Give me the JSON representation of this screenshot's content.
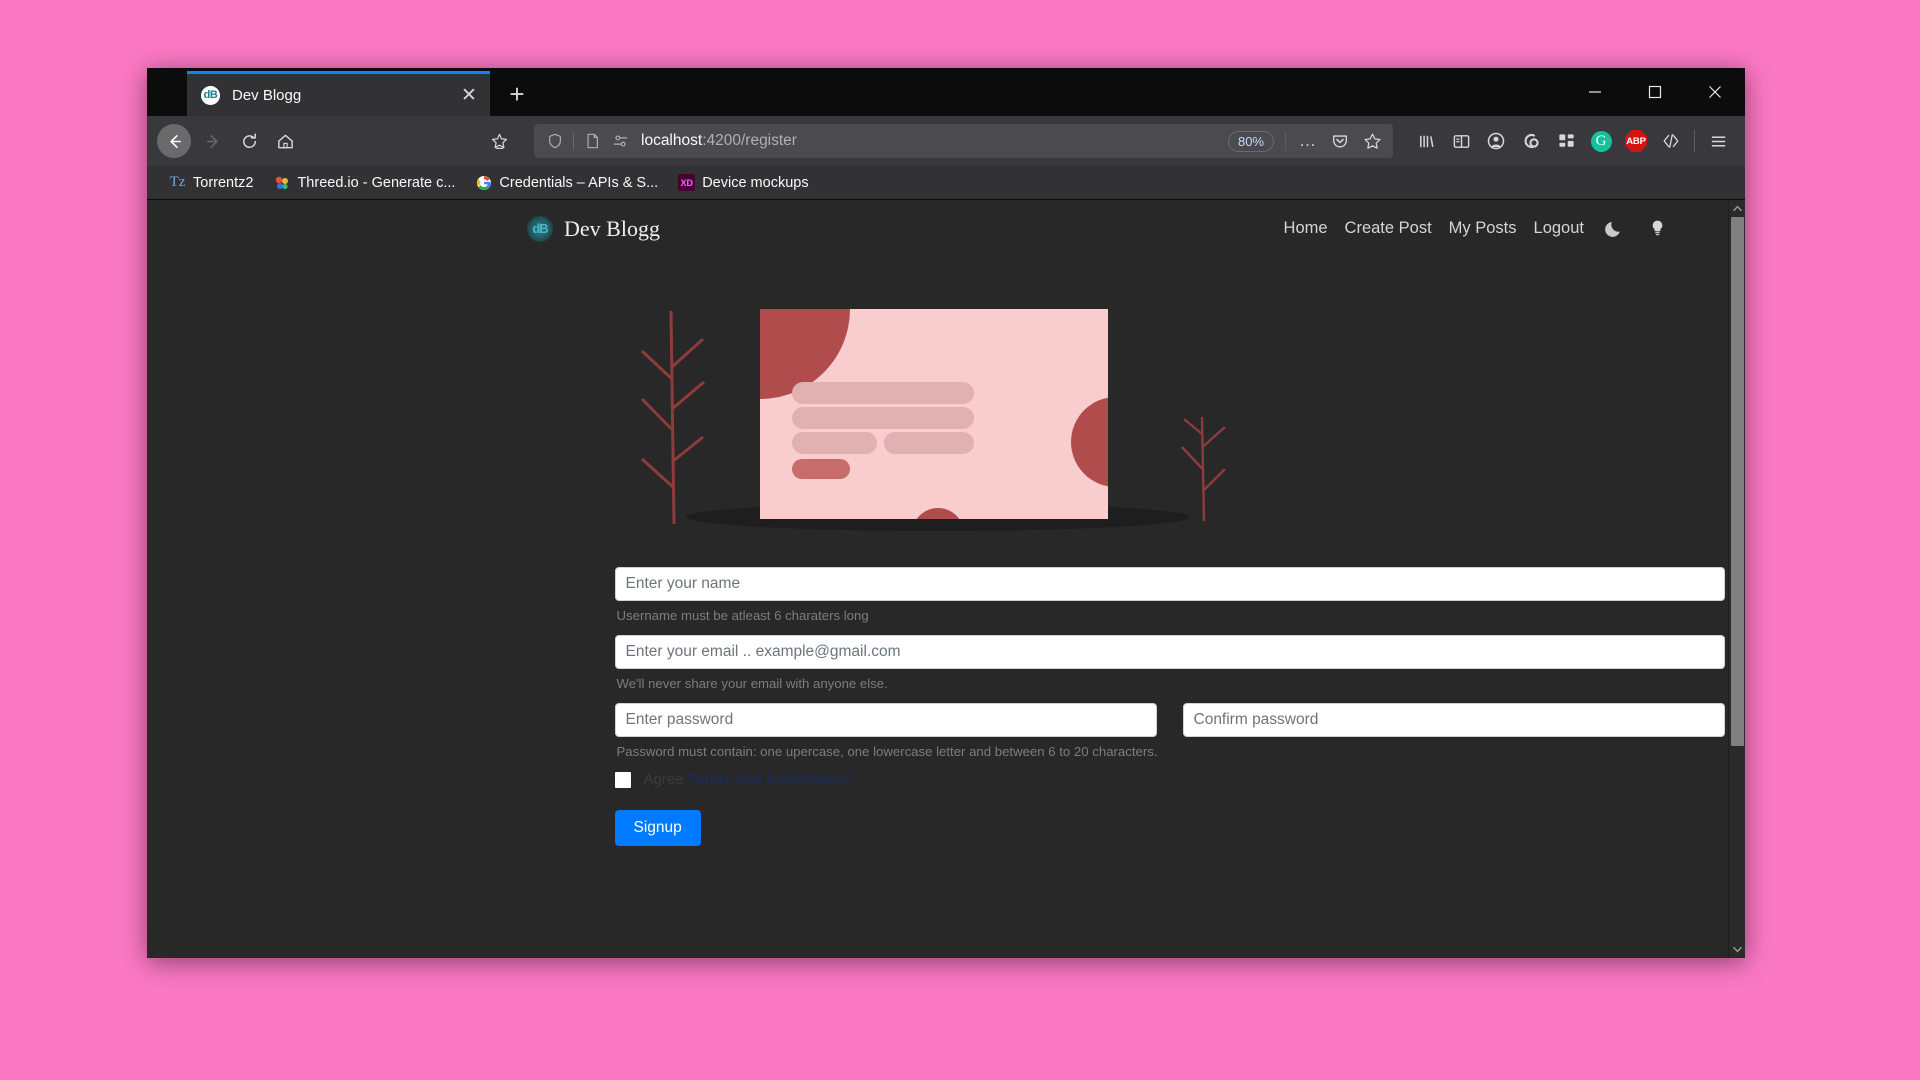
{
  "browser": {
    "tab": {
      "title": "Dev Blogg",
      "favicon_text": "dB",
      "close_label": "✕"
    },
    "new_tab_label": "+",
    "window_controls": {
      "minimize": "minimize-icon",
      "maximize": "maximize-icon",
      "close": "close-icon"
    },
    "nav": {
      "back": "back-arrow-icon",
      "forward": "forward-arrow-icon",
      "reload": "reload-icon",
      "home": "home-icon",
      "bookmark_star": "bookmark-star-icon"
    },
    "url": {
      "host": "localhost",
      "path": ":4200/register",
      "full": "localhost:4200/register",
      "shield_icon": "shield-icon",
      "page_icon": "page-icon",
      "permissions_icon": "permissions-icon"
    },
    "zoom_level": "80%",
    "url_actions": {
      "more": "…",
      "pocket": "pocket-icon",
      "star": "star-icon"
    },
    "toolbar_icons": [
      {
        "name": "library-icon",
        "label": "Library"
      },
      {
        "name": "sidebar-icon",
        "label": "Sidebars"
      },
      {
        "name": "account-icon",
        "label": "Account"
      },
      {
        "name": "sync-loop-icon",
        "label": "Sync"
      },
      {
        "name": "extensions-grid-icon",
        "label": "Extensions"
      },
      {
        "name": "grammarly-icon",
        "label": "G"
      },
      {
        "name": "adblock-plus-icon",
        "label": "ABP"
      },
      {
        "name": "code-brackets-icon",
        "label": "</>"
      },
      {
        "name": "hamburger-menu-icon",
        "label": "Menu"
      }
    ],
    "bookmarks": [
      {
        "icon": "torrentz-icon",
        "icon_text": "Tz",
        "label": "Torrentz2"
      },
      {
        "icon": "threed-io-icon",
        "icon_text": "🎨",
        "label": "Threed.io - Generate c..."
      },
      {
        "icon": "google-icon",
        "icon_text": "G",
        "label": "Credentials – APIs & S..."
      },
      {
        "icon": "adobe-xd-icon",
        "icon_text": "XD",
        "label": "Device mockups"
      }
    ]
  },
  "site": {
    "brand": {
      "logo_text": "dB",
      "name": "Dev Blogg"
    },
    "nav_links": [
      "Home",
      "Create Post",
      "My Posts",
      "Logout"
    ],
    "theme_icons": [
      {
        "name": "moon-icon",
        "glyph": "🌙"
      },
      {
        "name": "lightbulb-icon",
        "glyph": "💡"
      }
    ]
  },
  "illustration": {
    "name": "blog-card-illustration",
    "card_color": "#f9ccce",
    "accent_color": "#b04c4c",
    "bar_color": "#e0aeb0",
    "background": "#282828"
  },
  "form": {
    "name_field": {
      "placeholder": "Enter your name",
      "value": ""
    },
    "name_helper": "Username must be atleast 6 charaters long",
    "email_field": {
      "placeholder": "Enter your email .. example@gmail.com",
      "value": ""
    },
    "email_helper": "We'll never share your email with anyone else.",
    "password_field": {
      "placeholder": "Enter password",
      "value": ""
    },
    "confirm_field": {
      "placeholder": "Confirm password",
      "value": ""
    },
    "password_helper": "Password must contain: one upercase, one lowercase letter and between 6 to 20 characters.",
    "agree_prefix": "Agree ",
    "agree_terms": "Terms and Conditions*",
    "submit_label": "Signup",
    "accent_color": "#007bff"
  },
  "scrollbar": {
    "up": "scroll-up-arrow",
    "down": "scroll-down-arrow",
    "thumb": "scroll-thumb"
  }
}
